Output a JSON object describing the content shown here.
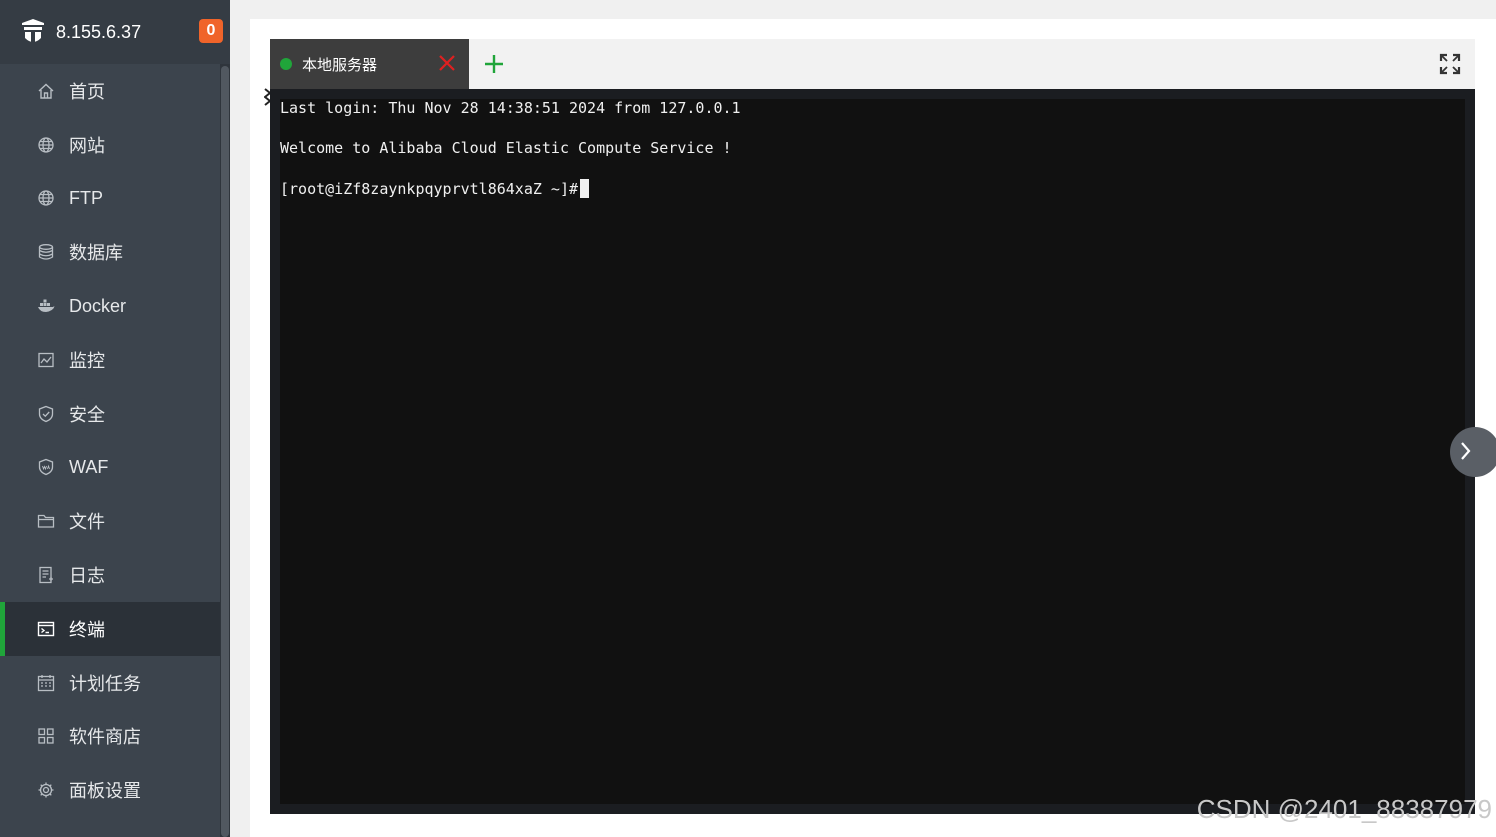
{
  "sidebar": {
    "server_ip": "8.155.6.37",
    "badge_count": "0",
    "items": [
      {
        "label": "首页",
        "icon": "home-icon"
      },
      {
        "label": "网站",
        "icon": "globe-icon"
      },
      {
        "label": "FTP",
        "icon": "ftp-globe-icon"
      },
      {
        "label": "数据库",
        "icon": "database-icon"
      },
      {
        "label": "Docker",
        "icon": "docker-icon"
      },
      {
        "label": "监控",
        "icon": "monitor-chart-icon"
      },
      {
        "label": "安全",
        "icon": "shield-check-icon"
      },
      {
        "label": "WAF",
        "icon": "waf-shield-icon"
      },
      {
        "label": "文件",
        "icon": "folder-icon"
      },
      {
        "label": "日志",
        "icon": "log-file-icon"
      },
      {
        "label": "终端",
        "icon": "terminal-icon",
        "active": true
      },
      {
        "label": "计划任务",
        "icon": "calendar-icon"
      },
      {
        "label": "软件商店",
        "icon": "app-grid-icon"
      },
      {
        "label": "面板设置",
        "icon": "gear-icon"
      }
    ]
  },
  "terminal": {
    "tab_label": "本地服务器",
    "status_color": "#20a53a",
    "lines": [
      "Last login: Thu Nov 28 14:38:51 2024 from 127.0.0.1",
      "Welcome to Alibaba Cloud Elastic Compute Service !",
      "[root@iZf8zaynkpqyprvtl864xaZ ~]#"
    ]
  },
  "watermark": "CSDN @2401_88387979",
  "colors": {
    "sidebar_bg": "#3c444d",
    "accent_green": "#20a53a",
    "badge_orange": "#f0642a",
    "terminal_bg": "#111111"
  }
}
